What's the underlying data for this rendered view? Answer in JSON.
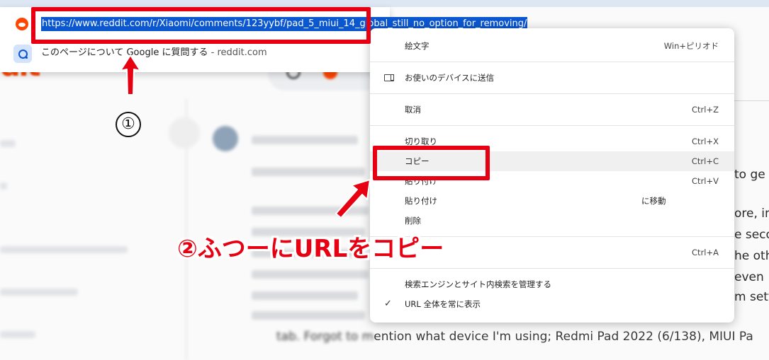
{
  "omnibox": {
    "url": "https://www.reddit.com/r/Xiaomi/comments/123yybf/pad_5_miui_14_global_still_no_option_for_removing/",
    "suggestion_text": "このページについて Google に質問する",
    "suggestion_separator": " - ",
    "suggestion_host": "reddit.com"
  },
  "context_menu": {
    "emoji": {
      "label": "絵文字",
      "shortcut": "Win+ピリオド"
    },
    "send_to_devices": {
      "label": "お使いのデバイスに送信"
    },
    "undo": {
      "label": "取消",
      "shortcut": "Ctrl+Z"
    },
    "cut": {
      "label": "切り取り",
      "shortcut": "Ctrl+X"
    },
    "copy": {
      "label": "コピー",
      "shortcut": "Ctrl+C"
    },
    "paste": {
      "label": "貼り付け",
      "shortcut": "Ctrl+V"
    },
    "paste_and_go": {
      "label": "貼り付け",
      "suffix": "に移動"
    },
    "delete": {
      "label": "削除"
    },
    "select_all": {
      "shortcut": "Ctrl+A"
    },
    "manage_search": {
      "label": "検索エンジンとサイト内検索を管理する"
    },
    "show_full_url": {
      "check": "✓",
      "label": "URL 全体を常に表示"
    }
  },
  "annotations": {
    "step1_marker": "①",
    "step2_caption": "②ふつーにURLをコピー"
  },
  "background": {
    "brand_fragment": "dit",
    "post_line": "ention what device I'm using; Redmi Pad 2022 (6/138), MIUI Pa",
    "post_blur_prefix": "tab. Forgot to m",
    "right_fragments": [
      "to ge",
      "ore, in",
      "e seco",
      "he oth",
      "even",
      "m sett"
    ]
  },
  "colors": {
    "annotation_red": "#e60012",
    "url_selection": "#0b57d0",
    "reddit_orange": "#ff4500"
  }
}
